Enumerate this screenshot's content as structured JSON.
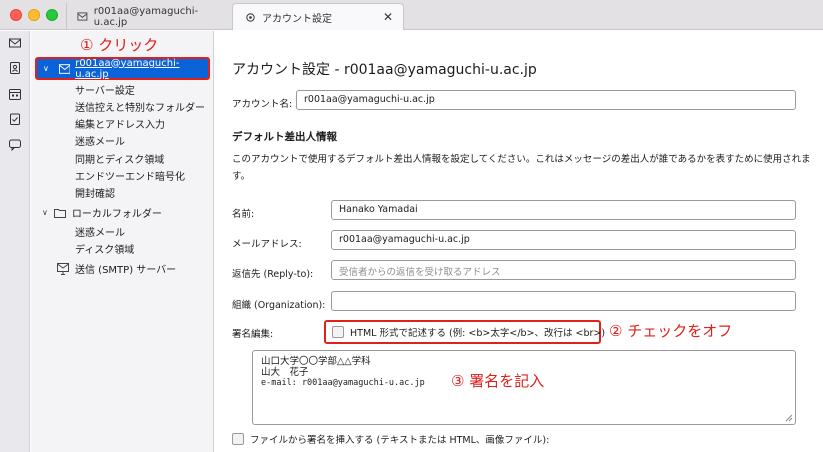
{
  "tabs": [
    {
      "label": "r001aa@yamaguchi-u.ac.jp",
      "icon": "mail-tab-icon"
    },
    {
      "label": "アカウント設定",
      "icon": "gear-icon",
      "close": "✕"
    }
  ],
  "rail_icons": [
    "mail-icon",
    "address-book-icon",
    "calendar-icon",
    "tasks-icon",
    "chat-icon"
  ],
  "annotations": {
    "click": "① クリック",
    "uncheck": "② チェックをオフ",
    "signature": "③ 署名を記入",
    "color": "#e0201b"
  },
  "folder_tree": {
    "account": "r001aa@yamaguchi-u.ac.jp",
    "account_items": [
      "サーバー設定",
      "送信控えと特別なフォルダー",
      "編集とアドレス入力",
      "迷惑メール",
      "同期とディスク領域",
      "エンドツーエンド暗号化",
      "開封確認"
    ],
    "local": "ローカルフォルダー",
    "local_items": [
      "迷惑メール",
      "ディスク領域"
    ],
    "smtp": "送信 (SMTP) サーバー"
  },
  "settings": {
    "title": "アカウント設定 - r001aa@yamaguchi-u.ac.jp",
    "account_name_label": "アカウント名:",
    "account_name_value": "r001aa@yamaguchi-u.ac.jp",
    "section_title": "デフォルト差出人情報",
    "description": "このアカウントで使用するデフォルト差出人情報を設定してください。これはメッセージの差出人が誰であるかを表すために使用されます。",
    "name_label": "名前:",
    "name_value": "Hanako Yamadai",
    "email_label": "メールアドレス:",
    "email_value": "r001aa@yamaguchi-u.ac.jp",
    "reply_to_label": "返信先 (Reply-to):",
    "reply_to_placeholder": "受信者からの返信を受け取るアドレス",
    "org_label": "組織 (Organization):",
    "org_value": "",
    "signature_label": "署名編集:",
    "html_checkbox_label": "HTML 形式で記述する (例: <b>太字</b>、改行は <br>)",
    "html_checked": false,
    "signature_lines": [
      "山口大学〇〇学部△△学科",
      "山大　花子",
      "e-mail: r001aa@yamaguchi-u.ac.jp"
    ],
    "file_checkbox_label": "ファイルから署名を挿入する (テキストまたは HTML、画像ファイル):",
    "file_checked": false
  },
  "colors": {
    "accent": "#0a63d8",
    "highlight_border": "#e0201b"
  }
}
